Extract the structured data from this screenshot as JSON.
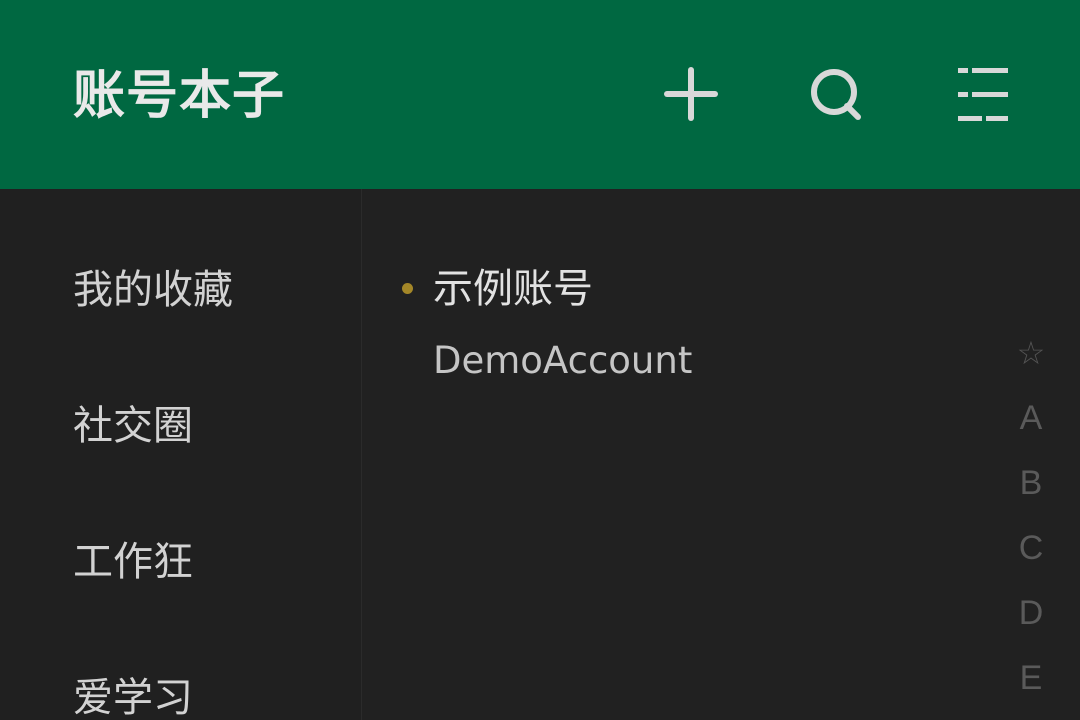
{
  "app": {
    "title": "账号本子"
  },
  "toolbar": {
    "add_icon": "plus-icon",
    "search_icon": "search-icon",
    "filter_icon": "filter-icon"
  },
  "sidebar": {
    "items": [
      {
        "label": "我的收藏"
      },
      {
        "label": "社交圈"
      },
      {
        "label": "工作狂"
      },
      {
        "label": "爱学习"
      }
    ]
  },
  "accounts": [
    {
      "name": "示例账号",
      "username": "DemoAccount",
      "marker_color": "#a48728"
    }
  ],
  "index_rail": {
    "items": [
      "☆",
      "A",
      "B",
      "C",
      "D",
      "E"
    ]
  },
  "colors": {
    "appbar": "#006841",
    "background": "#202020",
    "text_primary": "#e2e2e2",
    "text_secondary": "#c5c5c5",
    "index_letters": "#5a5a5a"
  }
}
